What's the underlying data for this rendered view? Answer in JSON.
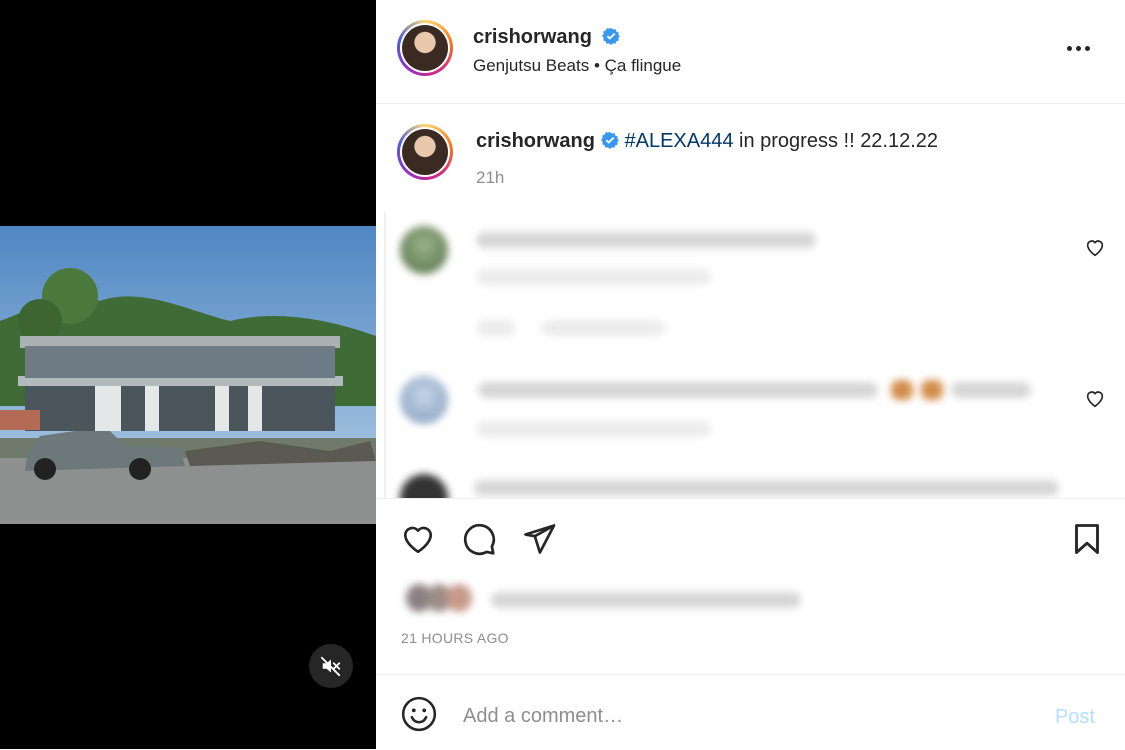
{
  "author": {
    "username": "crishorwang",
    "verified": true,
    "audio": "Genjutsu Beats • Ça flingue"
  },
  "caption": {
    "username": "crishorwang",
    "hashtag": "#ALEXA444",
    "text": " in progress !! 22.12.22",
    "time": "21h"
  },
  "timestamp": "21 HOURS AGO",
  "comment_box": {
    "placeholder": "Add a comment…",
    "post_label": "Post"
  },
  "icons": {
    "more": "more-horizontal-icon",
    "like": "heart-icon",
    "comment": "comment-icon",
    "share": "send-icon",
    "save": "bookmark-icon",
    "mute": "speaker-muted-icon",
    "emoji": "emoji-icon"
  },
  "colors": {
    "verified_blue": "#3897f0",
    "hashtag": "#00376b",
    "post_button": "#b2dffc",
    "muted_text": "#8e8e8e"
  }
}
